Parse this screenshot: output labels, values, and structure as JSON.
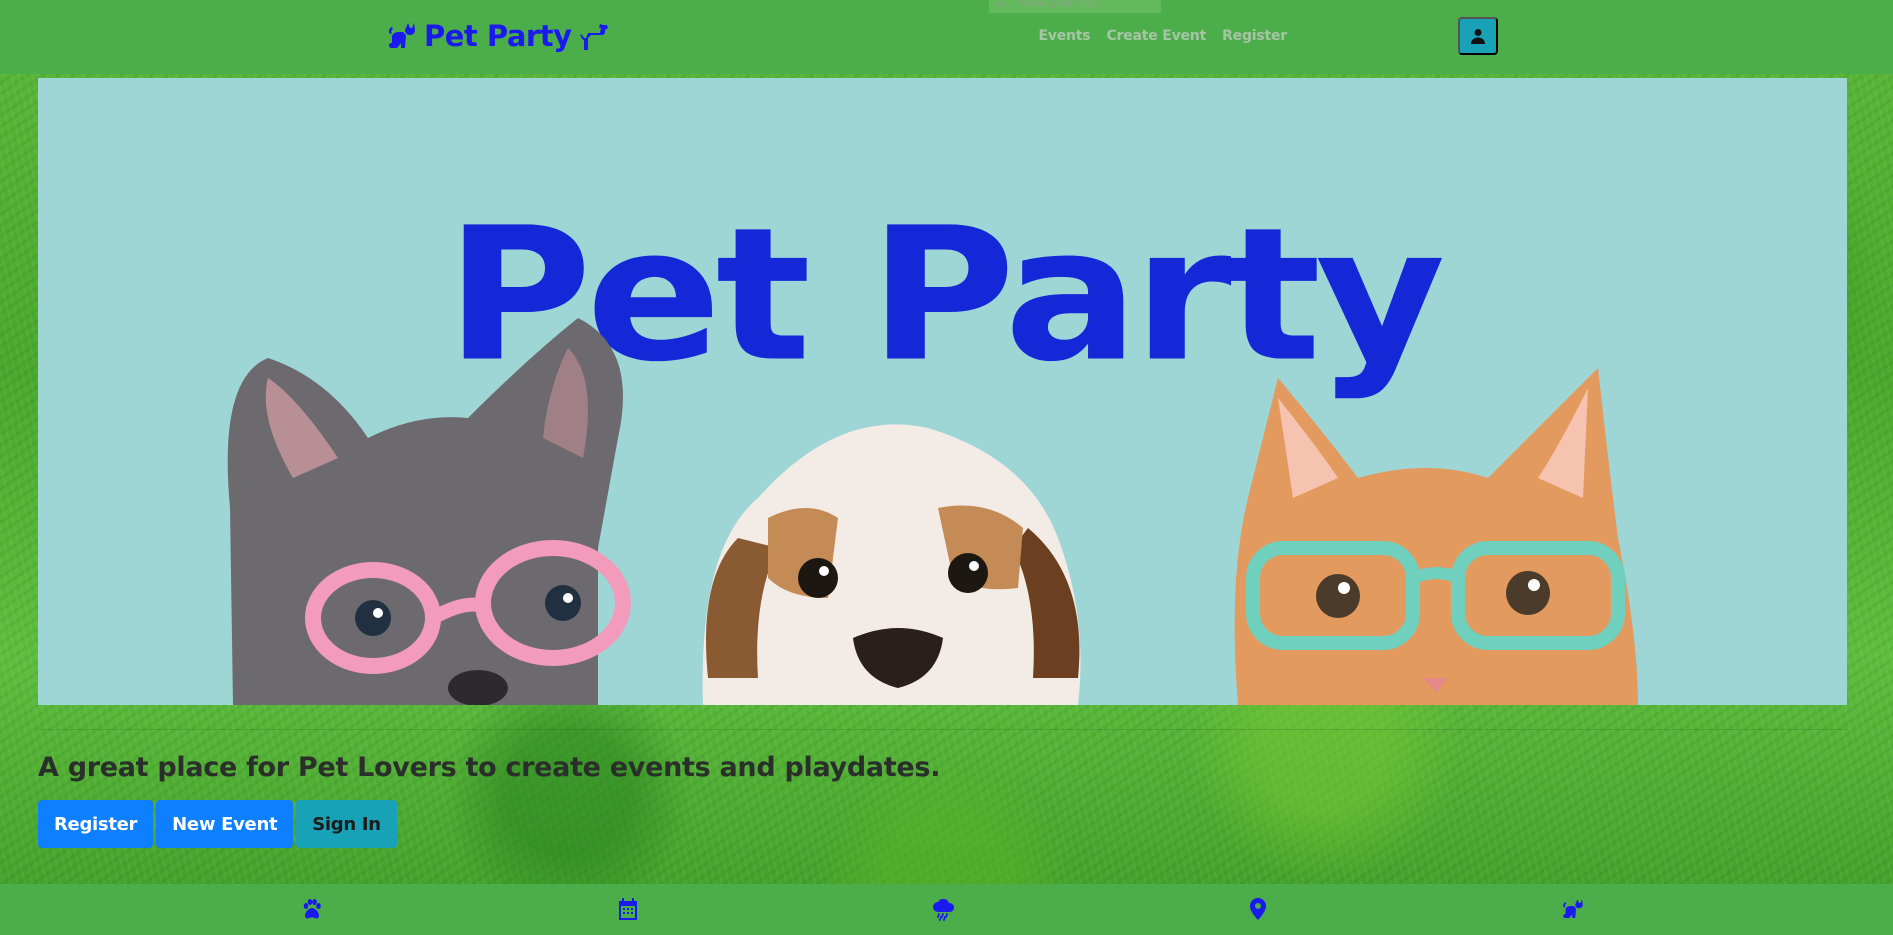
{
  "navbar": {
    "brand": "Pet Party",
    "search_placeholder": "Rectangular Snip",
    "links": [
      "Events",
      "Create Event",
      "Register"
    ],
    "user_button_icon": "user-icon"
  },
  "hero": {
    "title": "Pet Party",
    "image_description_pets": [
      "french bulldog with pink glasses",
      "bulldog puppy",
      "ginger kitten with teal glasses"
    ]
  },
  "main": {
    "tagline": "A great place for Pet Lovers to create events and playdates.",
    "buttons": {
      "register": "Register",
      "new_event": "New Event",
      "sign_in": "Sign In"
    }
  },
  "footer": {
    "icons": [
      "paw-icon",
      "calendar-icon",
      "cloud-rain-icon",
      "map-marker-icon",
      "cat-icon"
    ]
  },
  "colors": {
    "brand": "#1a1aee",
    "navbar": "#4cae4a",
    "hero_bg": "#9ed6d6",
    "hero_title": "#1428d8",
    "primary": "#0d7fff",
    "info": "#17a2b8"
  }
}
